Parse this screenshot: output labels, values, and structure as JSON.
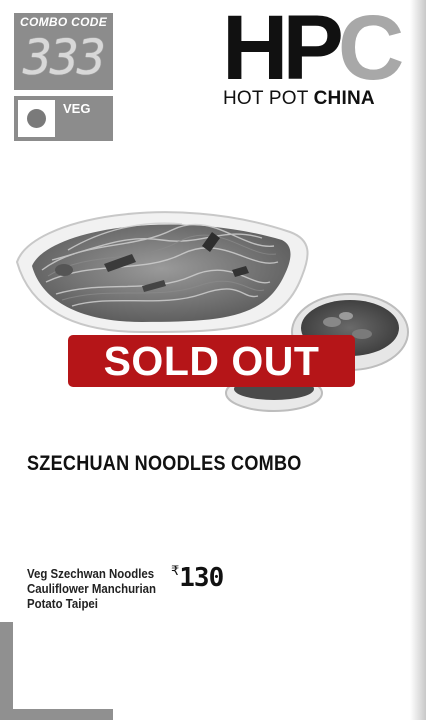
{
  "combo": {
    "label": "COMBO CODE",
    "code": "333"
  },
  "veg": {
    "label": "VEG"
  },
  "logo": {
    "letters": "HPC",
    "tagline_light": "HOT POT",
    "tagline_bold": "CHINA"
  },
  "status": {
    "sold_out": "SOLD OUT"
  },
  "title": "SZECHUAN NOODLES COMBO",
  "items": [
    "Veg Szechwan Noodles",
    "Cauliflower Manchurian",
    "Potato Taipei"
  ],
  "price": {
    "currency": "₹",
    "value": "130"
  },
  "colors": {
    "sold_out_bg": "#b51518",
    "box_grey": "#8c8c8c",
    "logo_c": "#a8a8a8"
  }
}
